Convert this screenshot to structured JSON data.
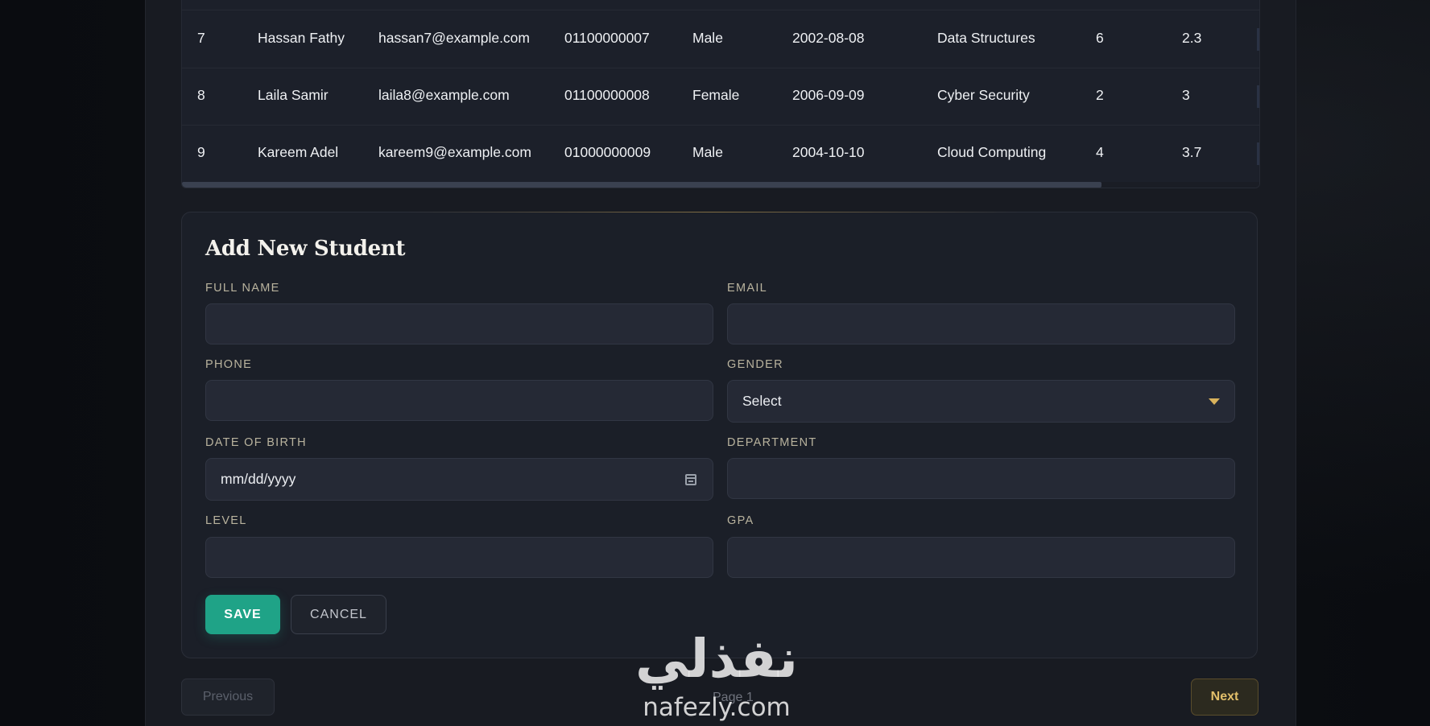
{
  "table": {
    "rows": [
      {
        "id": "7",
        "name": "Hassan Fathy",
        "email": "hassan7@example.com",
        "phone": "01100000007",
        "gender": "Male",
        "dob": "2002-08-08",
        "department": "Data Structures",
        "level": "6",
        "gpa": "2.3"
      },
      {
        "id": "8",
        "name": "Laila Samir",
        "email": "laila8@example.com",
        "phone": "01100000008",
        "gender": "Female",
        "dob": "2006-09-09",
        "department": "Cyber Security",
        "level": "2",
        "gpa": "3"
      },
      {
        "id": "9",
        "name": "Kareem Adel",
        "email": "kareem9@example.com",
        "phone": "01000000009",
        "gender": "Male",
        "dob": "2004-10-10",
        "department": "Cloud Computing",
        "level": "4",
        "gpa": "3.7"
      }
    ]
  },
  "form": {
    "title": "Add New Student",
    "labels": {
      "full_name": "FULL NAME",
      "email": "EMAIL",
      "phone": "PHONE",
      "gender": "GENDER",
      "dob": "DATE OF BIRTH",
      "department": "DEPARTMENT",
      "level": "LEVEL",
      "gpa": "GPA"
    },
    "values": {
      "full_name": "",
      "email": "",
      "phone": "",
      "gender": "Select",
      "dob_placeholder": "mm/dd/yyyy",
      "department": "",
      "level": "",
      "gpa": ""
    },
    "save_label": "SAVE",
    "cancel_label": "CANCEL"
  },
  "pagination": {
    "previous_label": "Previous",
    "page_label": "Page 1",
    "next_label": "Next"
  },
  "watermark": {
    "arabic": "نفذلي",
    "latin": "nafezly.com"
  },
  "colors": {
    "accent_gold": "#d9b25c",
    "save_green": "#1fa387",
    "background": "#0c0e12",
    "panel": "#181b22"
  },
  "icons": {
    "gender_dropdown": "chevron-down-icon",
    "dob_picker": "calendar-icon"
  }
}
